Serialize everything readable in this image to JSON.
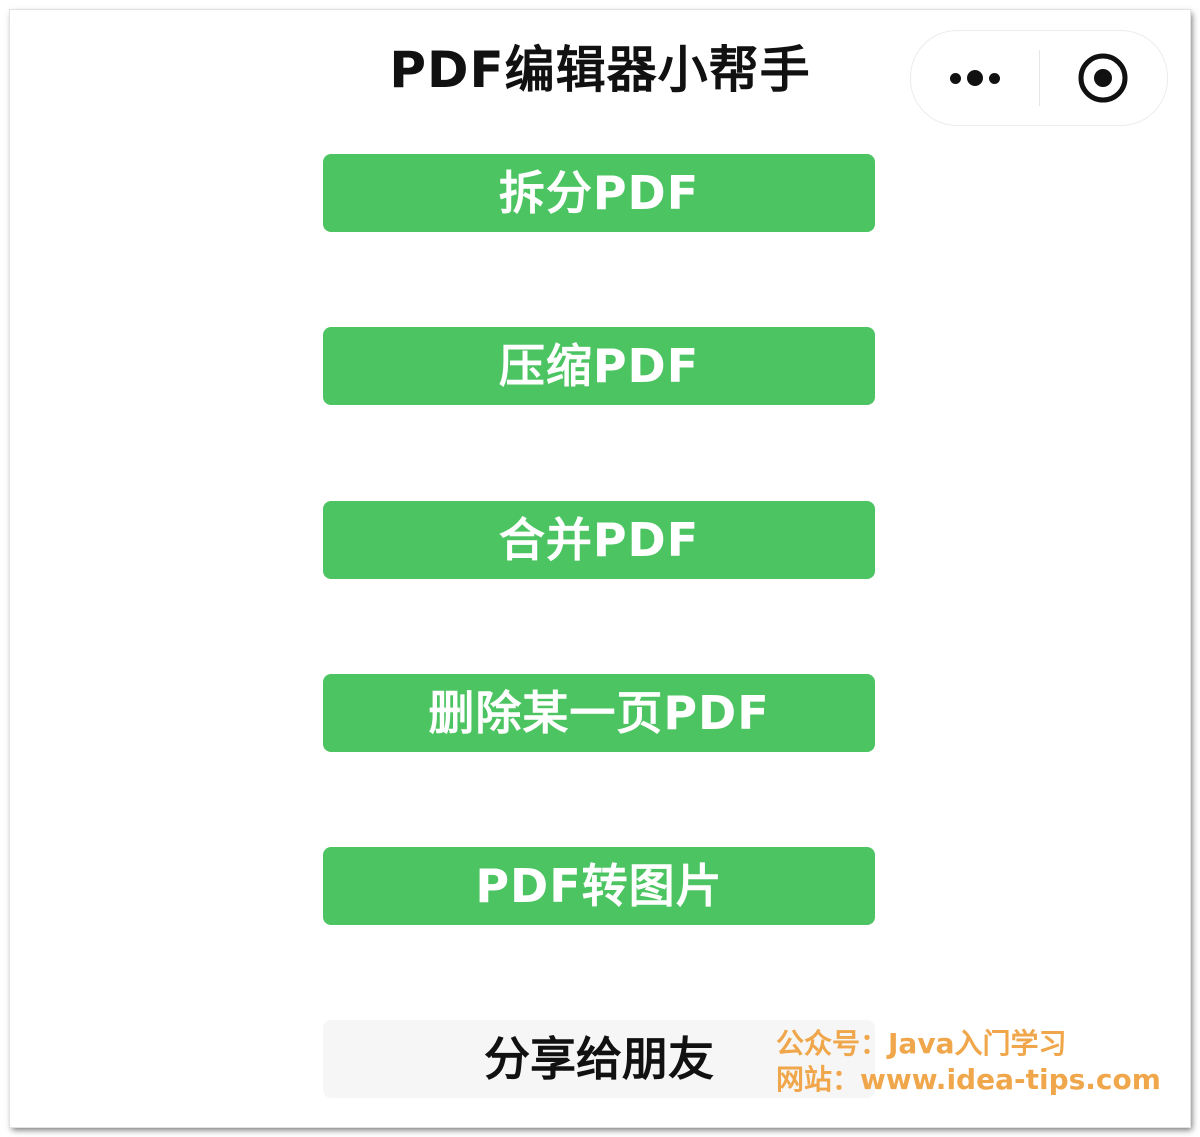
{
  "header": {
    "title": "PDF编辑器小帮手",
    "menu_icon": "more-dots-icon",
    "close_icon": "target-circle-icon"
  },
  "actions": [
    {
      "label": "拆分PDF"
    },
    {
      "label": "压缩PDF"
    },
    {
      "label": "合并PDF"
    },
    {
      "label": "删除某一页PDF"
    },
    {
      "label": "PDF转图片"
    }
  ],
  "share": {
    "label": "分享给朋友"
  },
  "watermark": {
    "line1": "公众号：Java入门学习",
    "line2": "网站：www.idea-tips.com"
  },
  "colors": {
    "button_green": "#4cc462",
    "watermark_orange": "#f0a64a"
  }
}
